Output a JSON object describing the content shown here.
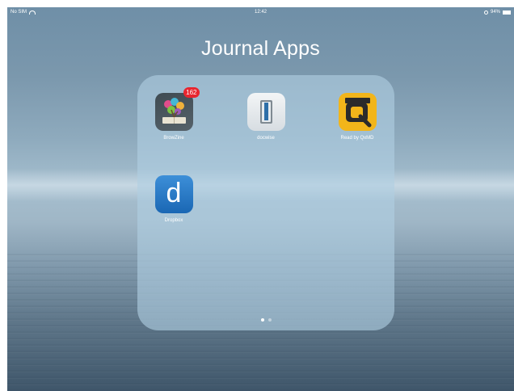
{
  "status_bar": {
    "carrier": "No SIM",
    "time": "12:42",
    "battery": "94%",
    "battery_level": 0.94
  },
  "folder": {
    "title": "Journal Apps",
    "page_count": 2,
    "current_page": 1
  },
  "apps": [
    {
      "label": "BrowZine",
      "icon": "browzine-icon",
      "badge": "162"
    },
    {
      "label": "docwise",
      "icon": "docwise-icon"
    },
    {
      "label": "Read by QxMD",
      "icon": "read-by-qxmd-icon"
    },
    {
      "label": "Dropbox",
      "icon": "dropbox-icon",
      "glyph": "d"
    }
  ],
  "colors": {
    "badge": "#e8262f",
    "readqxmd": "#f2b51a",
    "dropbox": "#1a67b4"
  }
}
